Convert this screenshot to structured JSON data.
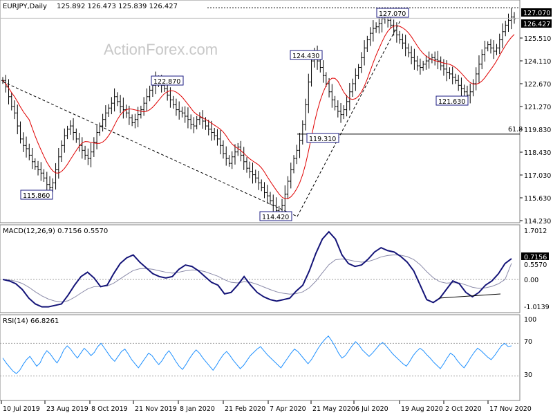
{
  "header": {
    "symbol": "EURJPY,Daily",
    "ohlc": "125.892 126.473 125.839 126.427",
    "watermark": "ActionForex.com"
  },
  "chart_data": [
    {
      "type": "candlestick",
      "name": "EURJPY,Daily",
      "ylim": [
        114.23,
        127.6
      ],
      "ticks": [
        "127.070",
        "126.427",
        "125.510",
        "124.110",
        "122.670",
        "121.270",
        "119.830",
        "118.430",
        "117.030",
        "115.630",
        "114.230"
      ],
      "x_labels": [
        "10 Jul 2019",
        "23 Aug 2019",
        "8 Oct 2019",
        "21 Nov 2019",
        "8 Jan 2020",
        "21 Feb 2020",
        "7 Apr 2020",
        "21 May 2020",
        "6 Jul 2020",
        "19 Aug 2020",
        "2 Oct 2020",
        "17 Nov 2020"
      ],
      "annotations": [
        {
          "label": "115.860",
          "value": 115.86
        },
        {
          "label": "122.870",
          "value": 122.87
        },
        {
          "label": "114.420",
          "value": 114.42
        },
        {
          "label": "124.430",
          "value": 124.43
        },
        {
          "label": "119.310",
          "value": 119.31
        },
        {
          "label": "127.070",
          "value": 127.07
        },
        {
          "label": "121.630",
          "value": 121.63
        }
      ],
      "fib_label": "61.8",
      "fib_level": 119.3,
      "resistance_level": 127.07,
      "last_price": 126.427,
      "close_series": [
        122.6,
        122.2,
        121.6,
        121.0,
        120.6,
        119.8,
        119.0,
        118.6,
        118.4,
        118.0,
        117.6,
        117.3,
        117.1,
        116.9,
        116.6,
        116.2,
        116.0,
        116.3,
        117.1,
        117.9,
        118.6,
        119.2,
        119.6,
        119.8,
        119.4,
        119.0,
        118.6,
        118.3,
        118.0,
        117.8,
        118.2,
        118.8,
        119.4,
        119.8,
        120.2,
        120.6,
        120.9,
        121.2,
        121.6,
        121.3,
        121.0,
        120.8,
        120.6,
        120.3,
        120.0,
        120.2,
        120.5,
        120.8,
        121.2,
        121.6,
        122.0,
        122.3,
        122.6,
        122.5,
        122.3,
        122.1,
        121.7,
        121.4,
        121.1,
        120.8,
        120.7,
        120.6,
        120.4,
        120.2,
        119.9,
        119.8,
        120.2,
        120.3,
        120.1,
        119.8,
        119.6,
        119.4,
        119.2,
        119.0,
        118.6,
        118.1,
        117.8,
        117.5,
        117.9,
        118.2,
        118.5,
        118.0,
        117.6,
        117.2,
        117.0,
        116.8,
        116.6,
        116.3,
        116.0,
        115.7,
        115.5,
        115.2,
        114.9,
        114.6,
        114.5,
        114.9,
        115.6,
        116.4,
        117.1,
        117.8,
        118.3,
        118.9,
        119.9,
        121.1,
        122.5,
        123.8,
        124.2,
        123.8,
        123.4,
        122.9,
        122.4,
        121.9,
        121.4,
        121.0,
        120.7,
        120.5,
        120.8,
        121.3,
        121.9,
        122.4,
        122.9,
        123.4,
        124.0,
        124.6,
        125.1,
        125.5,
        125.8,
        125.9,
        126.1,
        126.4,
        126.6,
        126.3,
        126.0,
        125.7,
        125.4,
        125.1,
        124.9,
        124.6,
        124.3,
        124.0,
        123.8,
        123.5,
        123.4,
        123.6,
        123.8,
        123.9,
        124.0,
        123.9,
        123.8,
        123.5,
        123.3,
        123.1,
        123.0,
        122.8,
        122.6,
        122.3,
        122.1,
        121.9,
        121.7,
        121.9,
        122.4,
        123.0,
        123.6,
        124.2,
        124.6,
        124.8,
        124.6,
        124.4,
        124.6,
        125.1,
        125.6,
        126.0,
        126.3,
        126.5,
        126.4
      ]
    },
    {
      "type": "line",
      "name": "MACD(12,26,9)",
      "title": "MACD(12,26,9) 0.7156 0.5570",
      "ticks": [
        "1.7012",
        "0.7156",
        "0.5570",
        "0.00",
        "-1.0139"
      ],
      "ylim": [
        -1.0139,
        1.7012
      ],
      "series": [
        {
          "name": "MACD",
          "values": [
            0.0,
            -0.05,
            -0.15,
            -0.35,
            -0.65,
            -0.85,
            -0.95,
            -0.95,
            -0.9,
            -0.85,
            -0.55,
            -0.2,
            0.1,
            0.25,
            0.05,
            -0.25,
            -0.2,
            0.2,
            0.55,
            0.75,
            0.85,
            0.6,
            0.4,
            0.2,
            0.1,
            0.05,
            0.1,
            0.35,
            0.5,
            0.45,
            0.3,
            0.1,
            -0.1,
            -0.2,
            -0.5,
            -0.45,
            -0.2,
            0.1,
            -0.2,
            -0.45,
            -0.6,
            -0.7,
            -0.75,
            -0.7,
            -0.65,
            -0.4,
            -0.2,
            0.3,
            0.9,
            1.4,
            1.65,
            1.4,
            0.85,
            0.55,
            0.45,
            0.5,
            0.7,
            0.95,
            1.1,
            1.0,
            0.95,
            0.8,
            0.6,
            0.3,
            -0.2,
            -0.7,
            -0.8,
            -0.65,
            -0.35,
            -0.05,
            -0.15,
            -0.45,
            -0.6,
            -0.45,
            -0.2,
            -0.05,
            0.2,
            0.55,
            0.72
          ]
        },
        {
          "name": "Signal",
          "values": [
            0.0,
            -0.02,
            -0.06,
            -0.14,
            -0.27,
            -0.43,
            -0.57,
            -0.68,
            -0.75,
            -0.78,
            -0.74,
            -0.62,
            -0.47,
            -0.33,
            -0.25,
            -0.24,
            -0.23,
            -0.13,
            0.02,
            0.17,
            0.31,
            0.37,
            0.38,
            0.35,
            0.3,
            0.25,
            0.22,
            0.25,
            0.3,
            0.33,
            0.32,
            0.27,
            0.19,
            0.11,
            -0.01,
            -0.1,
            -0.12,
            -0.08,
            -0.1,
            -0.17,
            -0.26,
            -0.35,
            -0.43,
            -0.48,
            -0.51,
            -0.49,
            -0.43,
            -0.29,
            -0.06,
            0.23,
            0.51,
            0.68,
            0.71,
            0.68,
            0.63,
            0.6,
            0.62,
            0.69,
            0.78,
            0.83,
            0.85,
            0.84,
            0.79,
            0.69,
            0.51,
            0.27,
            0.06,
            -0.08,
            -0.13,
            -0.11,
            -0.12,
            -0.19,
            -0.27,
            -0.31,
            -0.29,
            -0.24,
            -0.15,
            0.0,
            0.56
          ]
        }
      ]
    },
    {
      "type": "line",
      "name": "RSI(14)",
      "title": "RSI(14) 66.8261",
      "ticks": [
        "100",
        "70",
        "30",
        "0"
      ],
      "ylim": [
        0,
        100
      ],
      "levels": [
        70,
        30
      ],
      "last_value": 66.8261,
      "values": [
        52,
        46,
        41,
        36,
        33,
        37,
        44,
        50,
        54,
        48,
        42,
        46,
        55,
        61,
        57,
        51,
        46,
        53,
        62,
        67,
        63,
        57,
        52,
        58,
        64,
        60,
        55,
        59,
        66,
        70,
        64,
        58,
        52,
        48,
        54,
        60,
        63,
        57,
        50,
        45,
        40,
        46,
        52,
        58,
        55,
        49,
        44,
        49,
        56,
        61,
        55,
        48,
        42,
        38,
        44,
        51,
        57,
        62,
        58,
        52,
        47,
        42,
        37,
        43,
        50,
        56,
        60,
        55,
        49,
        44,
        39,
        43,
        49,
        55,
        59,
        63,
        66,
        61,
        56,
        52,
        48,
        44,
        40,
        46,
        52,
        58,
        63,
        60,
        55,
        50,
        45,
        50,
        57,
        64,
        70,
        75,
        79,
        73,
        66,
        58,
        52,
        55,
        61,
        67,
        72,
        68,
        62,
        58,
        54,
        58,
        63,
        68,
        71,
        67,
        62,
        57,
        53,
        49,
        45,
        42,
        48,
        55,
        60,
        64,
        61,
        56,
        52,
        47,
        43,
        39,
        45,
        52,
        58,
        55,
        49,
        44,
        40,
        46,
        53,
        59,
        64,
        61,
        57,
        53,
        50,
        55,
        61,
        67,
        70,
        66,
        67
      ]
    }
  ]
}
